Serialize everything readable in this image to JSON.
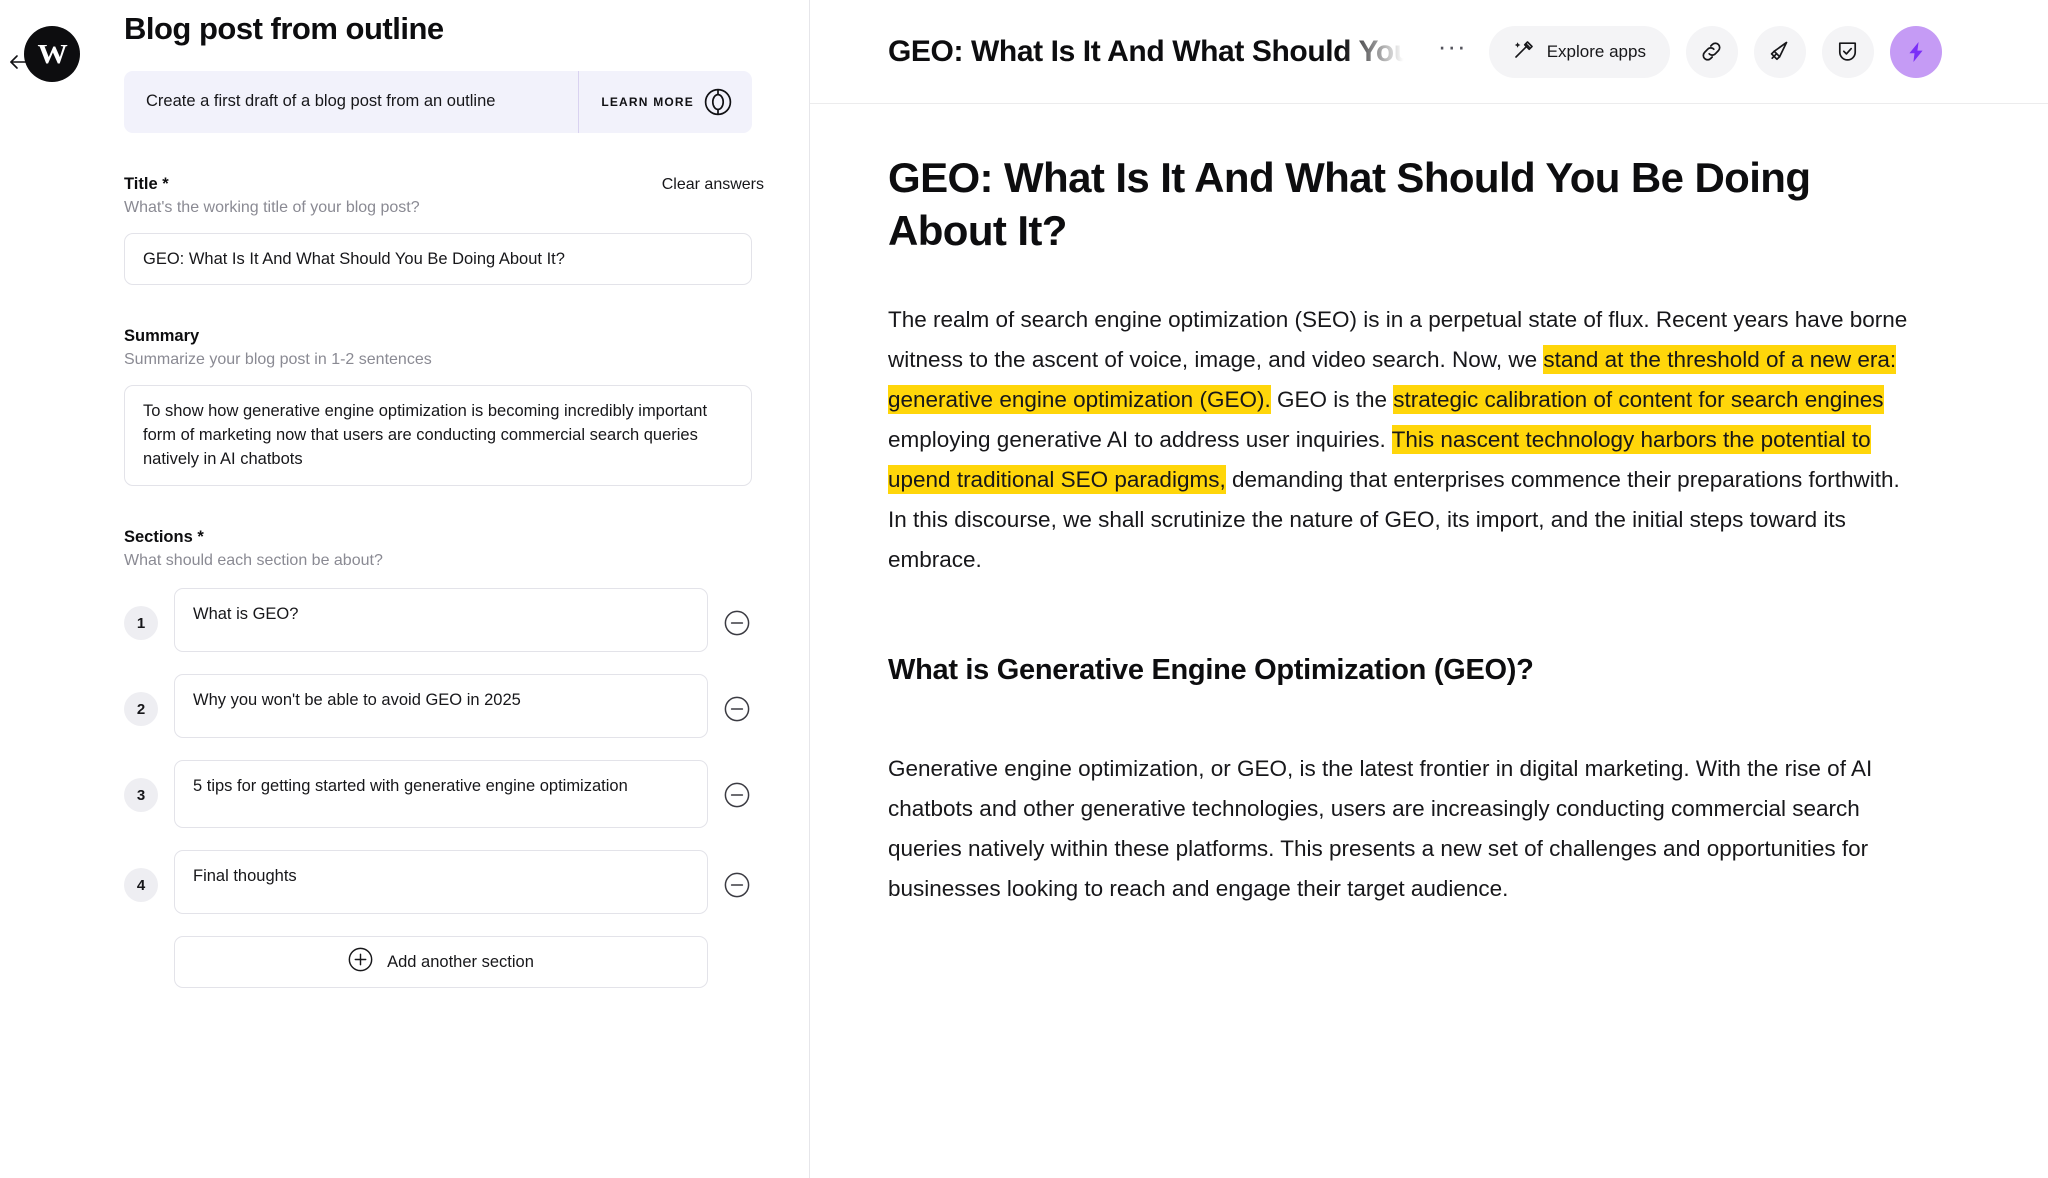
{
  "left": {
    "back_icon": "arrow-left-icon",
    "logo_mark": "W",
    "title": "Blog post from outline",
    "banner": {
      "description": "Create a first draft of a blog post from an outline",
      "learn_more_label": "LEARN MORE",
      "learn_more_icon": "lifebuoy-icon"
    },
    "clear_answers_label": "Clear answers",
    "fields": {
      "title": {
        "label": "Title *",
        "hint": "What's the working title of your blog post?",
        "value": "GEO: What Is It And What Should You Be Doing About It?",
        "placeholder": "What's the working title of your blog post?"
      },
      "summary": {
        "label": "Summary",
        "hint": "Summarize your blog post in 1-2 sentences",
        "value": "To show how generative engine optimization is becoming incredibly important form of marketing now that users are conducting commercial search queries natively in AI chatbots",
        "placeholder": "Summarize your blog post in 1-2 sentences"
      },
      "sections": {
        "label": "Sections *",
        "hint": "What should each section be about?",
        "items": [
          {
            "number": "1",
            "value": "What is GEO?"
          },
          {
            "number": "2",
            "value": "Why you won't be able to avoid GEO in 2025"
          },
          {
            "number": "3",
            "value": "5 tips for getting started with generative engine optimization"
          },
          {
            "number": "4",
            "value": "Final thoughts"
          }
        ],
        "remove_icon": "minus-circle-icon",
        "add_label": "Add another section",
        "add_icon": "plus-circle-icon"
      }
    }
  },
  "right": {
    "toolbar": {
      "doc_title": "GEO: What Is It And What Should You",
      "more_label": "···",
      "explore_apps_label": "Explore apps",
      "explore_apps_icon": "magic-pen-icon",
      "icons": [
        {
          "name": "link-icon"
        },
        {
          "name": "megaphone-icon"
        },
        {
          "name": "shield-check-icon"
        },
        {
          "name": "lightning-bolt-icon",
          "accent_color": "#c59bf5"
        }
      ]
    },
    "document": {
      "h1": "GEO: What Is It And What Should You Be Doing About It?",
      "paragraph1": {
        "part1": "The realm of search engine optimization (SEO) is in a perpetual state of flux. Recent years have borne witness to the ascent of voice, image, and video search. Now, we ",
        "highlight1": "stand at the threshold of a new era: generative engine optimization (GEO).",
        "part2": " GEO is the ",
        "highlight2": "strategic calibration of content for search engines",
        "part3": " employing generative AI to address user inquiries. ",
        "highlight3": "This nascent technology harbors the potential to upend traditional SEO paradigms,",
        "part4": " demanding that enterprises commence their preparations forthwith. In this discourse, we shall scrutinize the nature of GEO, its import, and the initial steps toward its embrace."
      },
      "h2": "What is Generative Engine Optimization (GEO)?",
      "paragraph2": "Generative engine optimization, or GEO, is the latest frontier in digital marketing. With the rise of AI chatbots and other generative technologies, users are increasingly conducting commercial search queries natively within these platforms. This presents a new set of challenges and opportunities for businesses looking to reach and engage their target audience.",
      "highlight_color": "#ffd60a"
    }
  }
}
